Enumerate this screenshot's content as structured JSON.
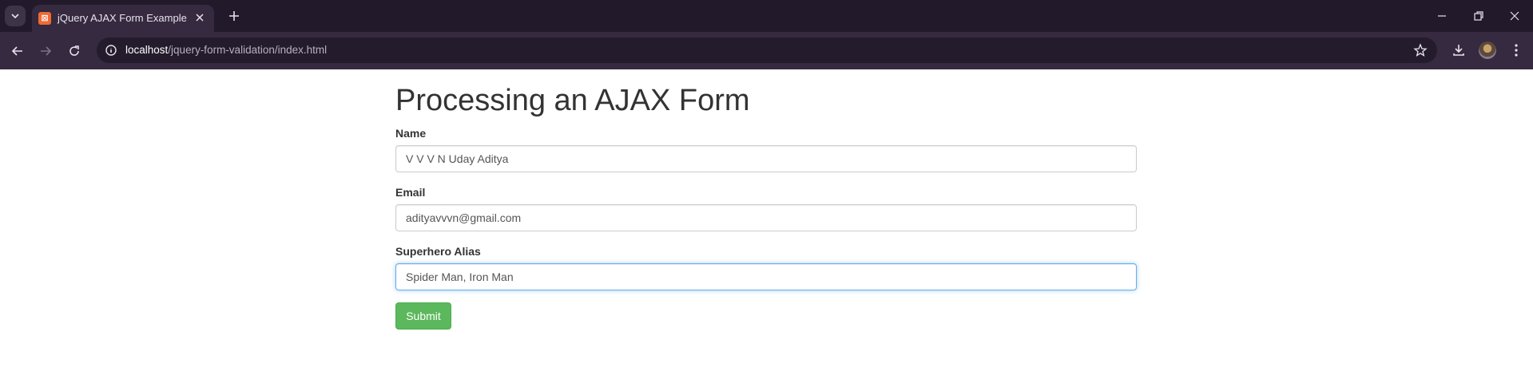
{
  "browser": {
    "tab": {
      "title": "jQuery AJAX Form Example",
      "favicon": "xampp-icon"
    },
    "address": {
      "host": "localhost",
      "path": "/jquery-form-validation/index.html"
    }
  },
  "form": {
    "heading": "Processing an AJAX Form",
    "name": {
      "label": "Name",
      "value": "V V V N Uday Aditya"
    },
    "email": {
      "label": "Email",
      "value": "adityavvvn@gmail.com"
    },
    "alias": {
      "label": "Superhero Alias",
      "value": "Spider Man, Iron Man"
    },
    "submit_label": "Submit"
  },
  "colors": {
    "chrome_top": "#221a2b",
    "chrome_bar": "#352a3f",
    "submit_green": "#5cb85c",
    "focus_blue": "#66afe9"
  }
}
